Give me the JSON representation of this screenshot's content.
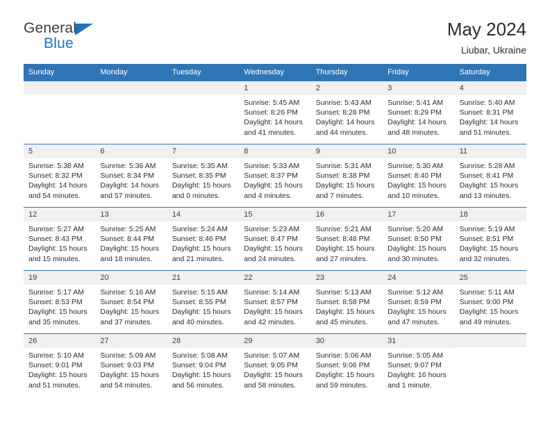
{
  "brand": {
    "word_one": "General",
    "word_two": "Blue",
    "triangle_color": "#1c72bd",
    "text_color": "#3b3b3b"
  },
  "header": {
    "title": "May 2024",
    "subtitle": "Liubar, Ukraine"
  },
  "theme": {
    "header_bg": "#3075b5",
    "header_text": "#ffffff",
    "daynum_bg": "#f0f0f0",
    "row_rule": "#3075b5",
    "body_text": "#2b2b2b"
  },
  "calendar": {
    "weekdays": [
      "Sunday",
      "Monday",
      "Tuesday",
      "Wednesday",
      "Thursday",
      "Friday",
      "Saturday"
    ],
    "labels": {
      "sunrise": "Sunrise:",
      "sunset": "Sunset:",
      "daylight": "Daylight:"
    },
    "weeks": [
      [
        {
          "day": ""
        },
        {
          "day": ""
        },
        {
          "day": ""
        },
        {
          "day": "1",
          "sunrise": "Sunrise: 5:45 AM",
          "sunset": "Sunset: 8:26 PM",
          "daylight": "Daylight: 14 hours and 41 minutes."
        },
        {
          "day": "2",
          "sunrise": "Sunrise: 5:43 AM",
          "sunset": "Sunset: 8:28 PM",
          "daylight": "Daylight: 14 hours and 44 minutes."
        },
        {
          "day": "3",
          "sunrise": "Sunrise: 5:41 AM",
          "sunset": "Sunset: 8:29 PM",
          "daylight": "Daylight: 14 hours and 48 minutes."
        },
        {
          "day": "4",
          "sunrise": "Sunrise: 5:40 AM",
          "sunset": "Sunset: 8:31 PM",
          "daylight": "Daylight: 14 hours and 51 minutes."
        }
      ],
      [
        {
          "day": "5",
          "sunrise": "Sunrise: 5:38 AM",
          "sunset": "Sunset: 8:32 PM",
          "daylight": "Daylight: 14 hours and 54 minutes."
        },
        {
          "day": "6",
          "sunrise": "Sunrise: 5:36 AM",
          "sunset": "Sunset: 8:34 PM",
          "daylight": "Daylight: 14 hours and 57 minutes."
        },
        {
          "day": "7",
          "sunrise": "Sunrise: 5:35 AM",
          "sunset": "Sunset: 8:35 PM",
          "daylight": "Daylight: 15 hours and 0 minutes."
        },
        {
          "day": "8",
          "sunrise": "Sunrise: 5:33 AM",
          "sunset": "Sunset: 8:37 PM",
          "daylight": "Daylight: 15 hours and 4 minutes."
        },
        {
          "day": "9",
          "sunrise": "Sunrise: 5:31 AM",
          "sunset": "Sunset: 8:38 PM",
          "daylight": "Daylight: 15 hours and 7 minutes."
        },
        {
          "day": "10",
          "sunrise": "Sunrise: 5:30 AM",
          "sunset": "Sunset: 8:40 PM",
          "daylight": "Daylight: 15 hours and 10 minutes."
        },
        {
          "day": "11",
          "sunrise": "Sunrise: 5:28 AM",
          "sunset": "Sunset: 8:41 PM",
          "daylight": "Daylight: 15 hours and 13 minutes."
        }
      ],
      [
        {
          "day": "12",
          "sunrise": "Sunrise: 5:27 AM",
          "sunset": "Sunset: 8:43 PM",
          "daylight": "Daylight: 15 hours and 15 minutes."
        },
        {
          "day": "13",
          "sunrise": "Sunrise: 5:25 AM",
          "sunset": "Sunset: 8:44 PM",
          "daylight": "Daylight: 15 hours and 18 minutes."
        },
        {
          "day": "14",
          "sunrise": "Sunrise: 5:24 AM",
          "sunset": "Sunset: 8:46 PM",
          "daylight": "Daylight: 15 hours and 21 minutes."
        },
        {
          "day": "15",
          "sunrise": "Sunrise: 5:23 AM",
          "sunset": "Sunset: 8:47 PM",
          "daylight": "Daylight: 15 hours and 24 minutes."
        },
        {
          "day": "16",
          "sunrise": "Sunrise: 5:21 AM",
          "sunset": "Sunset: 8:48 PM",
          "daylight": "Daylight: 15 hours and 27 minutes."
        },
        {
          "day": "17",
          "sunrise": "Sunrise: 5:20 AM",
          "sunset": "Sunset: 8:50 PM",
          "daylight": "Daylight: 15 hours and 30 minutes."
        },
        {
          "day": "18",
          "sunrise": "Sunrise: 5:19 AM",
          "sunset": "Sunset: 8:51 PM",
          "daylight": "Daylight: 15 hours and 32 minutes."
        }
      ],
      [
        {
          "day": "19",
          "sunrise": "Sunrise: 5:17 AM",
          "sunset": "Sunset: 8:53 PM",
          "daylight": "Daylight: 15 hours and 35 minutes."
        },
        {
          "day": "20",
          "sunrise": "Sunrise: 5:16 AM",
          "sunset": "Sunset: 8:54 PM",
          "daylight": "Daylight: 15 hours and 37 minutes."
        },
        {
          "day": "21",
          "sunrise": "Sunrise: 5:15 AM",
          "sunset": "Sunset: 8:55 PM",
          "daylight": "Daylight: 15 hours and 40 minutes."
        },
        {
          "day": "22",
          "sunrise": "Sunrise: 5:14 AM",
          "sunset": "Sunset: 8:57 PM",
          "daylight": "Daylight: 15 hours and 42 minutes."
        },
        {
          "day": "23",
          "sunrise": "Sunrise: 5:13 AM",
          "sunset": "Sunset: 8:58 PM",
          "daylight": "Daylight: 15 hours and 45 minutes."
        },
        {
          "day": "24",
          "sunrise": "Sunrise: 5:12 AM",
          "sunset": "Sunset: 8:59 PM",
          "daylight": "Daylight: 15 hours and 47 minutes."
        },
        {
          "day": "25",
          "sunrise": "Sunrise: 5:11 AM",
          "sunset": "Sunset: 9:00 PM",
          "daylight": "Daylight: 15 hours and 49 minutes."
        }
      ],
      [
        {
          "day": "26",
          "sunrise": "Sunrise: 5:10 AM",
          "sunset": "Sunset: 9:01 PM",
          "daylight": "Daylight: 15 hours and 51 minutes."
        },
        {
          "day": "27",
          "sunrise": "Sunrise: 5:09 AM",
          "sunset": "Sunset: 9:03 PM",
          "daylight": "Daylight: 15 hours and 54 minutes."
        },
        {
          "day": "28",
          "sunrise": "Sunrise: 5:08 AM",
          "sunset": "Sunset: 9:04 PM",
          "daylight": "Daylight: 15 hours and 56 minutes."
        },
        {
          "day": "29",
          "sunrise": "Sunrise: 5:07 AM",
          "sunset": "Sunset: 9:05 PM",
          "daylight": "Daylight: 15 hours and 58 minutes."
        },
        {
          "day": "30",
          "sunrise": "Sunrise: 5:06 AM",
          "sunset": "Sunset: 9:06 PM",
          "daylight": "Daylight: 15 hours and 59 minutes."
        },
        {
          "day": "31",
          "sunrise": "Sunrise: 5:05 AM",
          "sunset": "Sunset: 9:07 PM",
          "daylight": "Daylight: 16 hours and 1 minute."
        },
        {
          "day": ""
        }
      ]
    ]
  }
}
